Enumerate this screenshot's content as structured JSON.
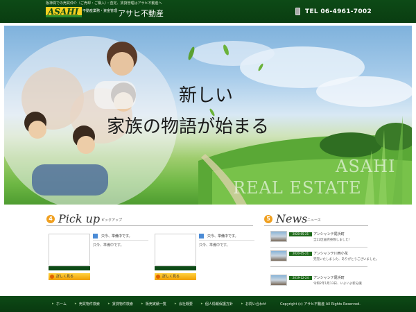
{
  "header": {
    "tagline": "阪神間での売買仲介（ご売却・ご購入）・査定、賃貸管理はアサヒ不動産へ",
    "logo_text": "ASAHI",
    "logo_subtitle": "不動産業務・資金管理",
    "brand_name": "アサヒ不動産",
    "tel": "TEL 06-4961-7002"
  },
  "hero": {
    "title_line1": "新しい",
    "title_line2": "家族の物語が始まる",
    "watermark_line1": "ASAHI",
    "watermark_line2": "REAL ESTATE"
  },
  "pickup": {
    "number": "4",
    "title": "Pick up",
    "subtitle": "ピックアップ",
    "cards": [
      {
        "title": "只今、準備中です。",
        "text": "只今、準備中です。",
        "button": "詳しく見る"
      },
      {
        "title": "只今、準備中です。",
        "text": "只今、準備中です。",
        "button": "詳しく見る"
      }
    ]
  },
  "news": {
    "number": "5",
    "title": "News",
    "subtitle": "ニュース",
    "items": [
      {
        "date": "2020-05-21",
        "title": "アンシャンテ尾浜町",
        "body": "全22区画完売致しました！"
      },
      {
        "date": "2020-05-21",
        "title": "アンシャンテ川西小花",
        "body": "完売いたしました、ありがとうございました。"
      },
      {
        "date": "2019-12-24",
        "title": "アンシャンテ尾浜町",
        "body": "令和2年1月13日、いよいよ新分譲"
      }
    ]
  },
  "footer": {
    "nav": [
      "ホーム",
      "売買物件検索",
      "賃貸物件検索",
      "販売実績一覧",
      "会社概要",
      "個人情報保護方針",
      "お問い合わせ"
    ],
    "copyright": "Copyright (c) アサヒ不動産 All Rights Reserved."
  },
  "colors": {
    "header_green": "#0d4a16",
    "accent_orange": "#f0a020",
    "news_date_green": "#1e6a1a"
  }
}
